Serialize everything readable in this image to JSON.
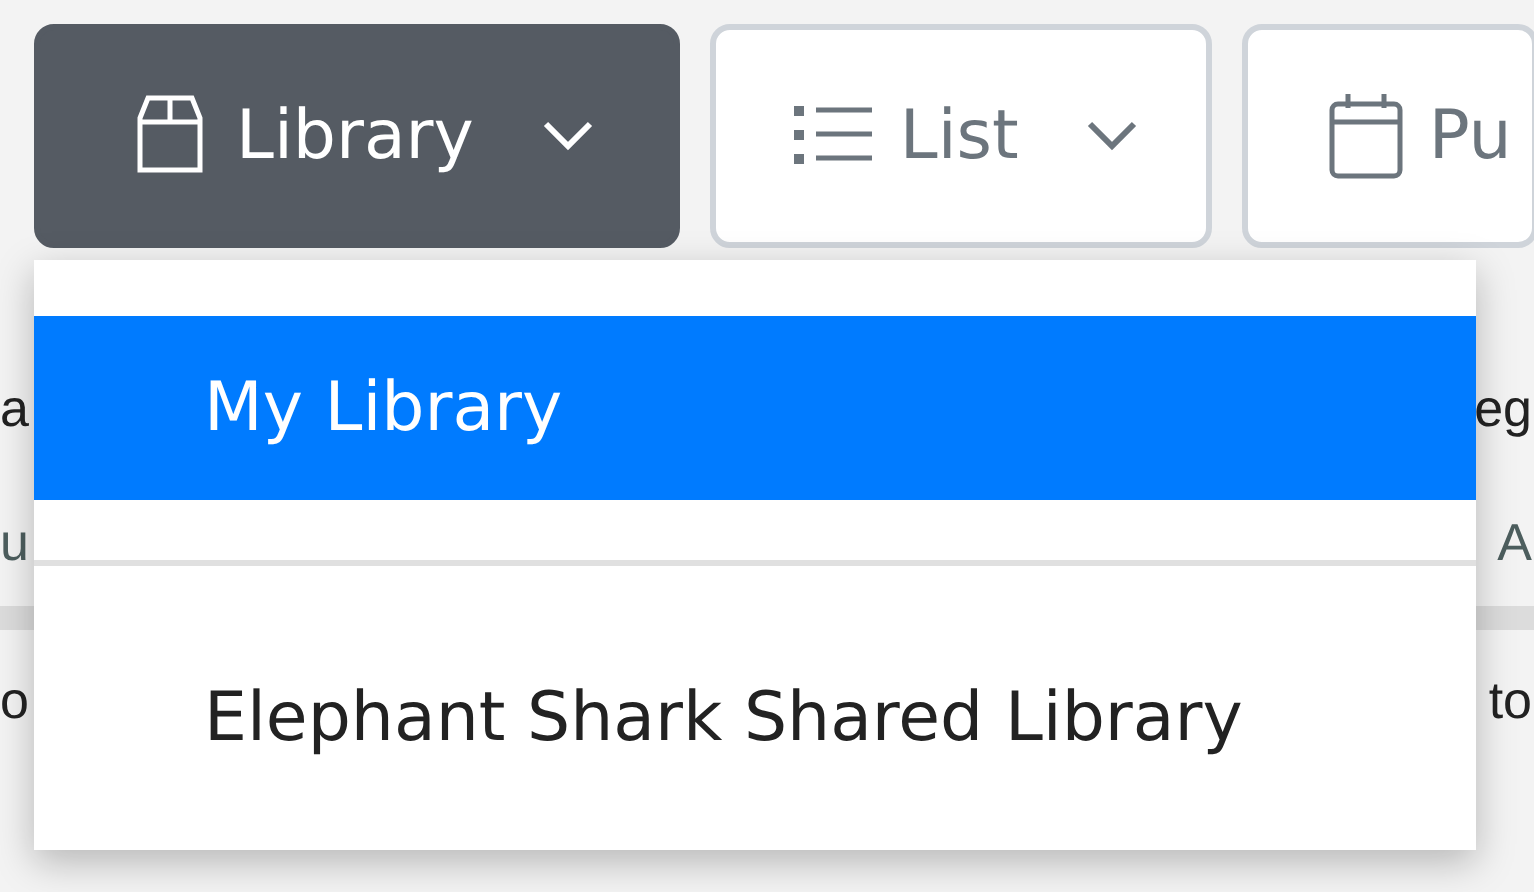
{
  "toolbar": {
    "buttons": [
      {
        "label": "Library",
        "kind": "library",
        "selected": true
      },
      {
        "label": "List",
        "kind": "list",
        "selected": false
      },
      {
        "label": "Pu",
        "kind": "calendar",
        "selected": false
      }
    ]
  },
  "background_rows": [
    {
      "left": "a",
      "right": "eg",
      "kind": "title"
    },
    {
      "left": "u",
      "right": "A",
      "kind": "meta"
    },
    {
      "left": "o",
      "right": "to",
      "kind": "title"
    }
  ],
  "dropdown": {
    "items": [
      {
        "label": "My Library",
        "selected": true
      },
      {
        "label": "Elephant Shark Shared Library",
        "selected": false
      }
    ]
  }
}
